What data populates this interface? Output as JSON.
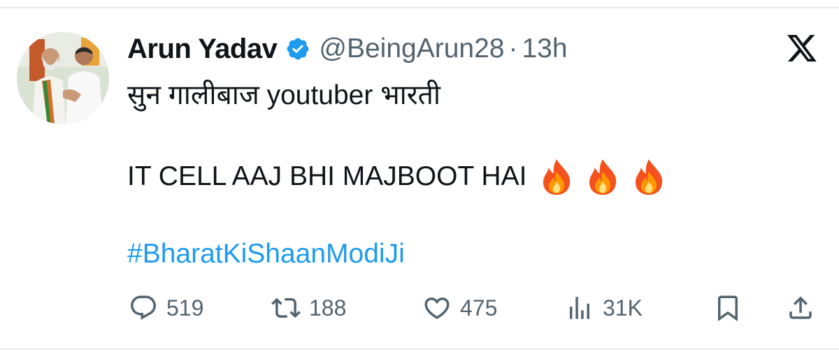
{
  "author": {
    "display_name": "Arun Yadav",
    "handle": "@BeingArun28",
    "separator": "·",
    "time": "13h",
    "verified_icon": "verified-badge-icon",
    "avatar": "profile-photo"
  },
  "brand": {
    "logo": "x-logo-icon"
  },
  "content": {
    "line1": "सुन गालीबाज youtuber भारती",
    "line2": "IT CELL AAJ BHI MAJBOOT HAI",
    "emoji": [
      "fire-emoji",
      "fire-emoji",
      "fire-emoji"
    ],
    "hashtag": "#BharatKiShaanModiJi"
  },
  "actions": {
    "reply_count": "519",
    "retweet_count": "188",
    "like_count": "475",
    "views_count": "31K"
  },
  "colors": {
    "text": "#0f1419",
    "secondary": "#536471",
    "accent": "#1d9bf0",
    "divider": "#e7e9ea"
  }
}
